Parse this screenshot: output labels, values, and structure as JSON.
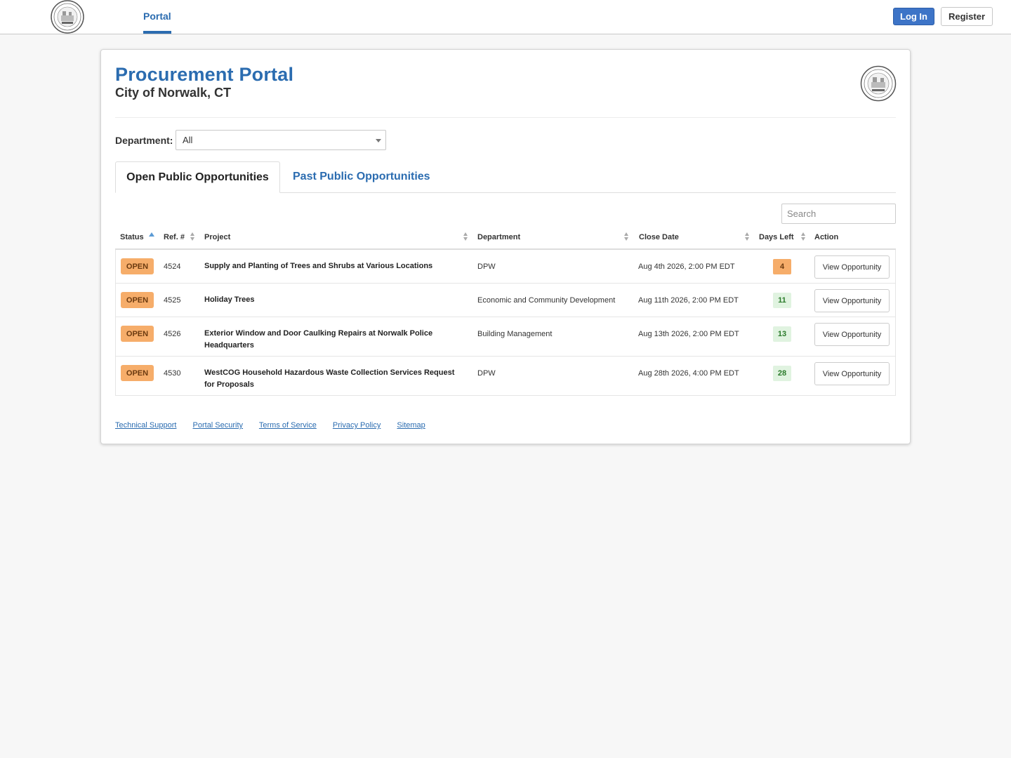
{
  "nav": {
    "tab": "Portal",
    "login": "Log In",
    "register": "Register"
  },
  "header": {
    "title": "Procurement Portal",
    "subtitle": "City of Norwalk, CT"
  },
  "filter": {
    "label": "Department:",
    "value": "All"
  },
  "tabs": {
    "open": "Open Public Opportunities",
    "past": "Past Public Opportunities"
  },
  "search": {
    "placeholder": "Search"
  },
  "table": {
    "headers": {
      "status": "Status",
      "ref": "Ref. #",
      "project": "Project",
      "department": "Department",
      "close_date": "Close Date",
      "days_left": "Days Left",
      "action": "Action"
    },
    "rows": [
      {
        "status": "OPEN",
        "ref": "4524",
        "project": "Supply and Planting of Trees and Shrubs at Various Locations",
        "department": "DPW",
        "close_date": "Aug 4th 2026, 2:00 PM EDT",
        "days_left": "4",
        "action": "View Opportunity"
      },
      {
        "status": "OPEN",
        "ref": "4525",
        "project": "Holiday Trees",
        "department": "Economic and Community Development",
        "close_date": "Aug 11th 2026, 2:00 PM EDT",
        "days_left": "11",
        "action": "View Opportunity"
      },
      {
        "status": "OPEN",
        "ref": "4526",
        "project": "Exterior Window and Door Caulking Repairs at Norwalk Police Headquarters",
        "department": "Building Management",
        "close_date": "Aug 13th 2026, 2:00 PM EDT",
        "days_left": "13",
        "action": "View Opportunity"
      },
      {
        "status": "OPEN",
        "ref": "4530",
        "project": "WestCOG Household Hazardous Waste Collection Services Request for Proposals",
        "department": "DPW",
        "close_date": "Aug 28th 2026, 4:00 PM EDT",
        "days_left": "28",
        "action": "View Opportunity"
      }
    ]
  },
  "footer": {
    "links": [
      "Technical Support",
      "Portal Security",
      "Terms of Service",
      "Privacy Policy",
      "Sitemap"
    ]
  },
  "colors": {
    "accent": "#2b6cb0",
    "open_badge": "#f6ad6a",
    "days_ok": "#e0f3e0"
  }
}
